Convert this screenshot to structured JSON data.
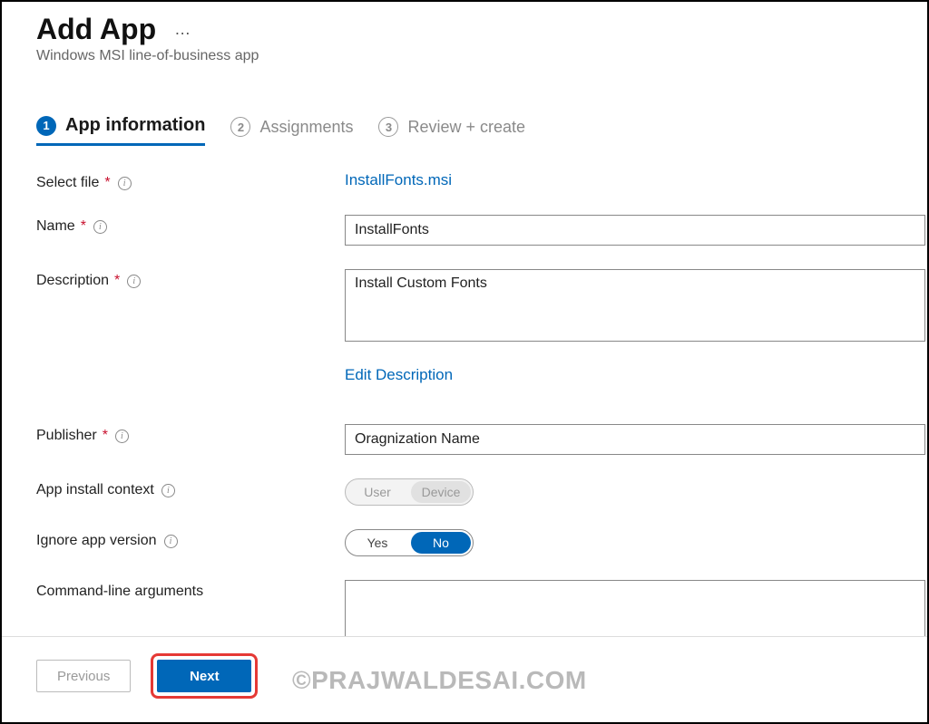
{
  "header": {
    "title": "Add App",
    "subtitle": "Windows MSI line-of-business app",
    "ellipsis": "…"
  },
  "tabs": [
    {
      "num": "1",
      "label": "App information",
      "active": true
    },
    {
      "num": "2",
      "label": "Assignments",
      "active": false
    },
    {
      "num": "3",
      "label": "Review + create",
      "active": false
    }
  ],
  "form": {
    "select_file": {
      "label": "Select file",
      "filename": "InstallFonts.msi"
    },
    "name": {
      "label": "Name",
      "value": "InstallFonts"
    },
    "description": {
      "label": "Description",
      "value": "Install Custom Fonts",
      "edit_link": "Edit Description"
    },
    "publisher": {
      "label": "Publisher",
      "value": "Oragnization Name"
    },
    "install_context": {
      "label": "App install context",
      "opt_a": "User",
      "opt_b": "Device"
    },
    "ignore_version": {
      "label": "Ignore app version",
      "opt_a": "Yes",
      "opt_b": "No"
    },
    "cmdline": {
      "label": "Command-line arguments",
      "value": ""
    }
  },
  "footer": {
    "previous": "Previous",
    "next": "Next"
  },
  "watermark": "©PRAJWALDESAI.COM"
}
